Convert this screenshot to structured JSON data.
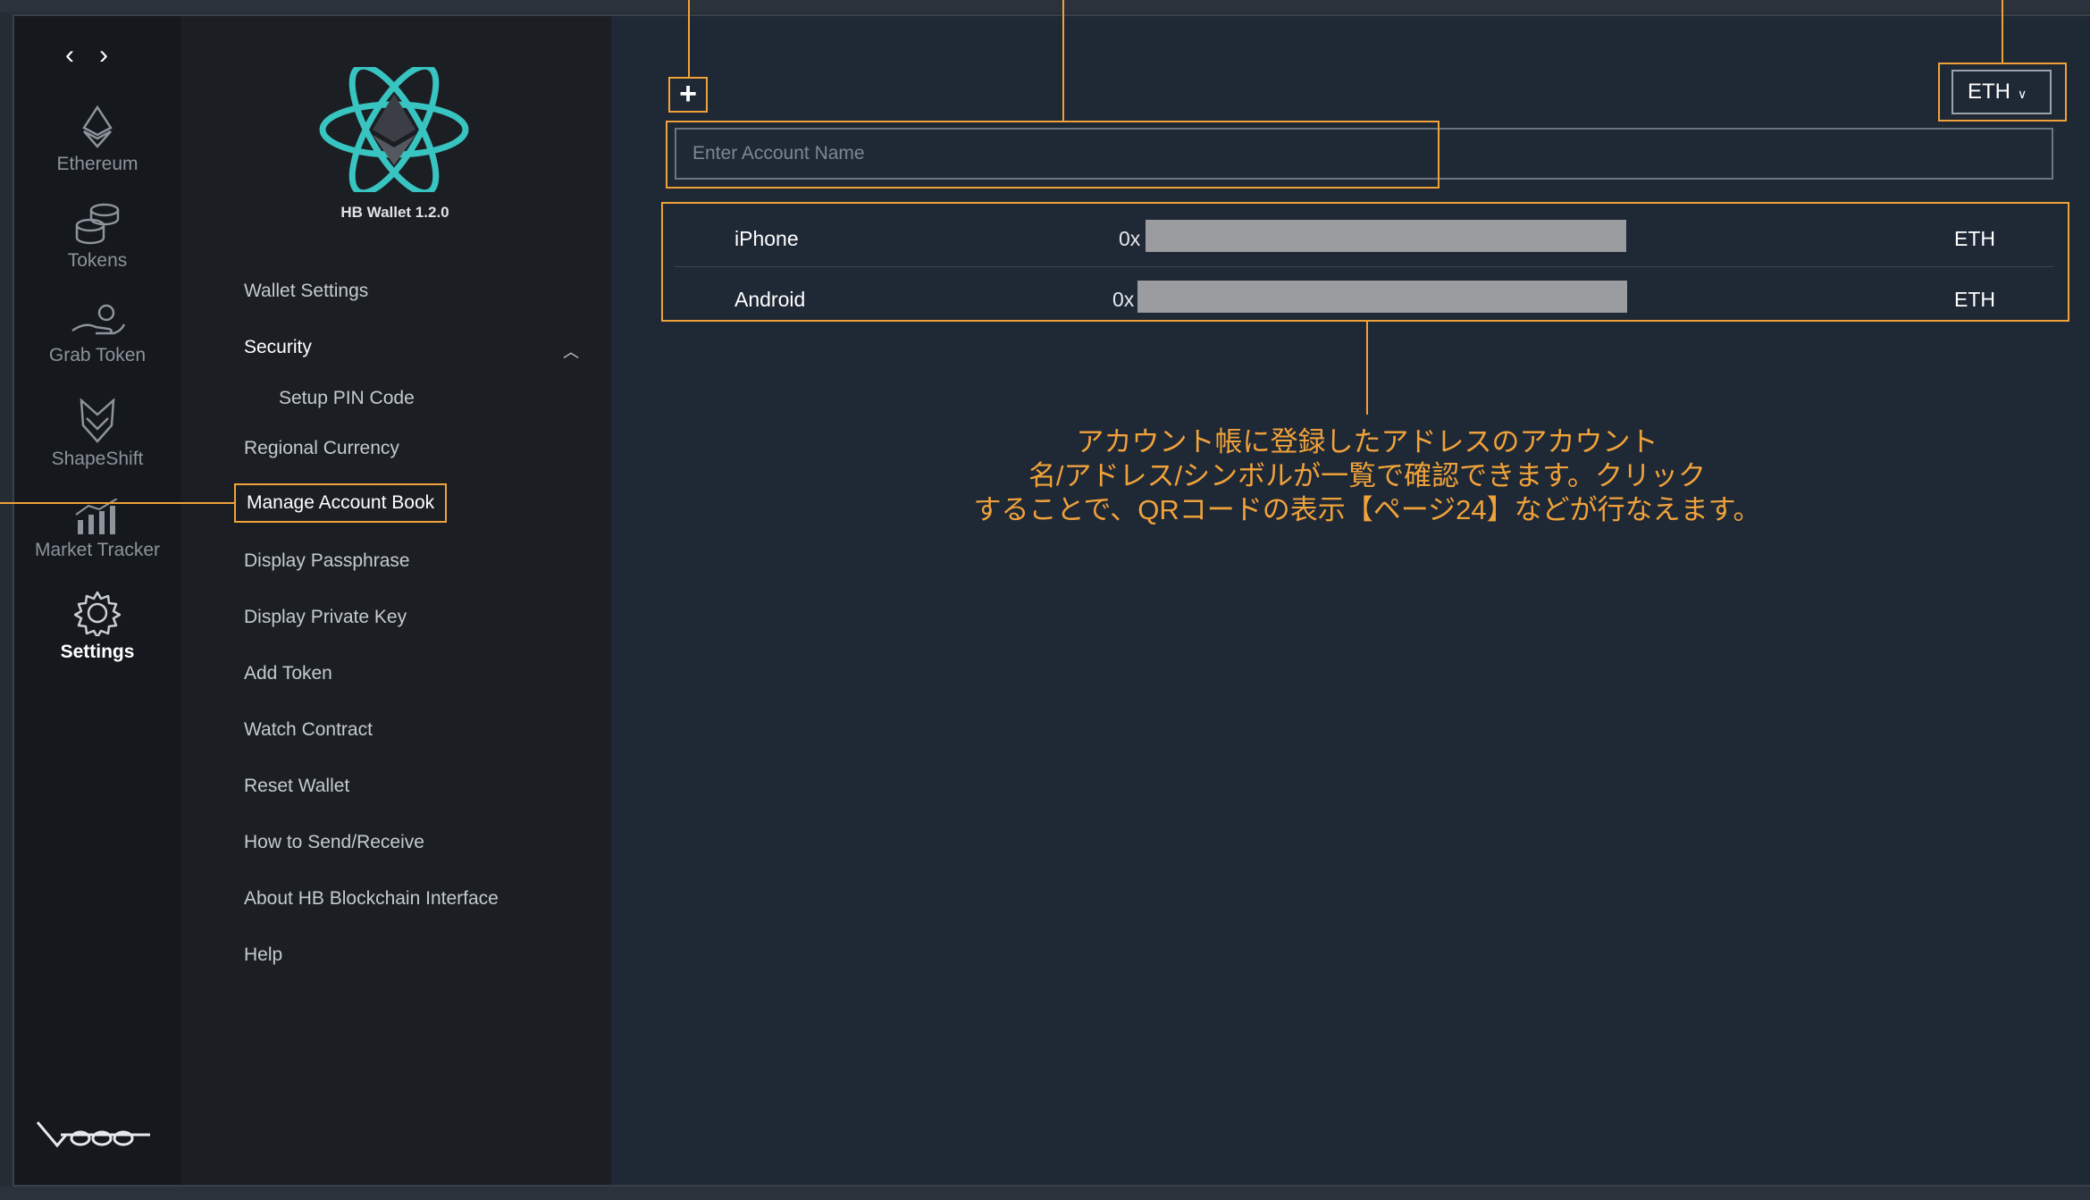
{
  "nav": {
    "back": "‹",
    "forward": "›"
  },
  "rail": {
    "items": [
      {
        "label": "Ethereum",
        "icon": "ethereum-icon"
      },
      {
        "label": "Tokens",
        "icon": "coins-icon"
      },
      {
        "label": "Grab Token",
        "icon": "hand-icon"
      },
      {
        "label": "ShapeShift",
        "icon": "fox-icon"
      },
      {
        "label": "Market Tracker",
        "icon": "chart-icon"
      },
      {
        "label": "Settings",
        "icon": "gear-icon"
      }
    ],
    "active": "Settings"
  },
  "app": {
    "version_label": "HB Wallet 1.2.0"
  },
  "menu": {
    "wallet_settings": "Wallet Settings",
    "security": "Security",
    "setup_pin": "Setup PIN Code",
    "regional_currency": "Regional Currency",
    "manage_account_book": "Manage Account Book",
    "display_passphrase": "Display Passphrase",
    "display_private_key": "Display Private Key",
    "add_token": "Add Token",
    "watch_contract": "Watch Contract",
    "reset_wallet": "Reset Wallet",
    "how_to_send": "How to Send/Receive",
    "about": "About HB Blockchain Interface",
    "help": "Help"
  },
  "main": {
    "add_button": "+",
    "account_name_placeholder": "Enter Account Name",
    "currency_select": "ETH",
    "accounts": [
      {
        "name": "iPhone",
        "address_prefix": "0x",
        "symbol": "ETH"
      },
      {
        "name": "Android",
        "address_prefix": "0x",
        "symbol": "ETH"
      }
    ]
  },
  "annotation": {
    "line1": "アカウント帳に登録したアドレスのアカウント",
    "line2": "名/アドレス/シンボルが一覧で確認できます。クリック",
    "line3": "することで、QRコードの表示【ページ24】などが行なえます。"
  },
  "colors": {
    "accent": "#f0a23a",
    "main_bg": "#1f2835",
    "rail_bg": "#15181c",
    "menu_bg": "#1b1f24"
  }
}
